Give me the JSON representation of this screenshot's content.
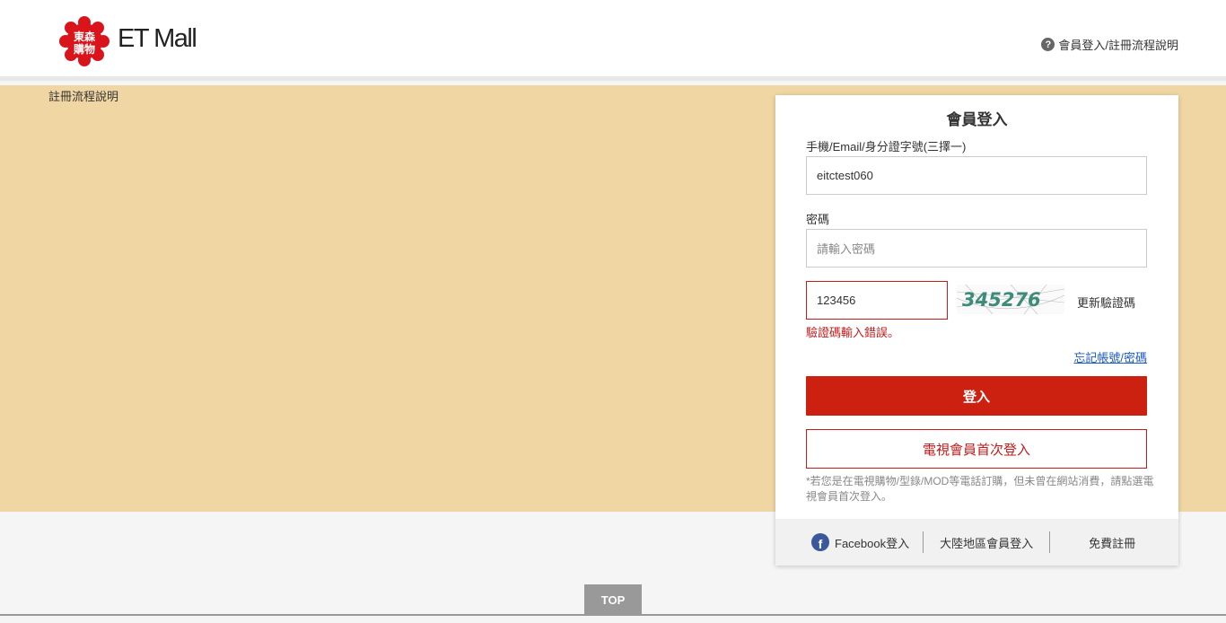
{
  "header": {
    "logo_text": "東森購物",
    "brand": "ET Mall",
    "help_link": "會員登入/註冊流程說明"
  },
  "banner": {
    "label": "註冊流程說明"
  },
  "login": {
    "title": "會員登入",
    "account_label": "手機/Email/身分證字號(三擇一)",
    "account_value": "eitctest060",
    "password_label": "密碼",
    "password_placeholder": "請輸入密碼",
    "captcha_value": "123456",
    "captcha_image_text": "345276",
    "refresh_captcha": "更新驗證碼",
    "error_message": "驗證碼輸入錯誤。",
    "forgot_link": "忘記帳號/密碼",
    "login_button": "登入",
    "tv_member_button": "電視會員首次登入",
    "note": "*若您是在電視購物/型錄/MOD等電話訂購，但未曾在網站消費，請點選電視會員首次登入。"
  },
  "footer_links": {
    "facebook": "Facebook登入",
    "mainland": "大陸地區會員登入",
    "register": "免費註冊"
  },
  "top_button": "TOP",
  "colors": {
    "accent": "#cc2010",
    "banner": "#f0d6a2",
    "error": "#c21c1c",
    "link": "#1a5ac4",
    "facebook": "#3a589b"
  }
}
